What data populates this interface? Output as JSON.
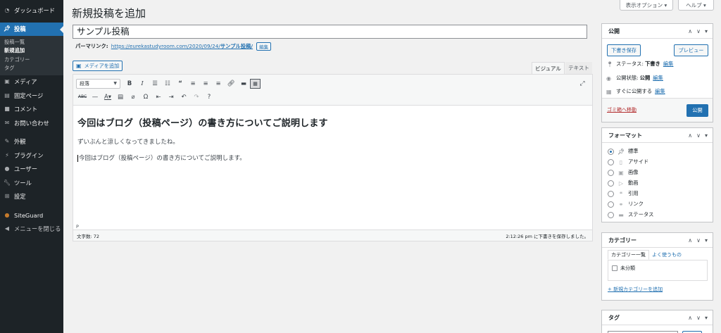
{
  "sidebar": {
    "items": [
      {
        "label": "ダッシュボード",
        "icon": "dashboard-icon"
      },
      {
        "label": "投稿",
        "icon": "pin-icon"
      },
      {
        "label": "メディア",
        "icon": "media-icon"
      },
      {
        "label": "固定ページ",
        "icon": "page-icon"
      },
      {
        "label": "コメント",
        "icon": "comment-icon"
      },
      {
        "label": "お問い合わせ",
        "icon": "mail-icon"
      },
      {
        "label": "外観",
        "icon": "brush-icon"
      },
      {
        "label": "プラグイン",
        "icon": "plugin-icon"
      },
      {
        "label": "ユーザー",
        "icon": "user-icon"
      },
      {
        "label": "ツール",
        "icon": "wrench-icon"
      },
      {
        "label": "設定",
        "icon": "settings-icon"
      },
      {
        "label": "SiteGuard",
        "icon": "siteguard-icon"
      },
      {
        "label": "メニューを閉じる",
        "icon": "collapse-icon"
      }
    ],
    "submenu": [
      "投稿一覧",
      "新規追加",
      "カテゴリー",
      "タグ"
    ]
  },
  "screen_tabs": {
    "options": "表示オプション ▾",
    "help": "ヘルプ ▾"
  },
  "page": {
    "title": "新規投稿を追加"
  },
  "post": {
    "title": "サンプル投稿",
    "permalink_label": "パーマリンク:",
    "permalink_base": "https://eurekastudyroom.com/2020/09/24/",
    "permalink_slug": "サンプル投稿/",
    "edit_label": "編集"
  },
  "editor": {
    "media_button": "メディアを追加",
    "tab_visual": "ビジュアル",
    "tab_text": "テキスト",
    "format_value": "段落",
    "heading": "今回はブログ（投稿ページ）の書き方についてご説明します",
    "paragraph1": "ずいぶんと涼しくなってきましたね。",
    "paragraph2": "今回はブログ（投稿ページ）の書き方についてご説明します。",
    "path": "P",
    "word_count": "文字数: 72",
    "autosave": "2:12:26 pm に下書きを保存しました。"
  },
  "publish": {
    "title": "公開",
    "save_draft": "下書き保存",
    "preview": "プレビュー",
    "status_label": "ステータス:",
    "status_value": "下書き",
    "visibility_label": "公開状態:",
    "visibility_value": "公開",
    "schedule_label": "すぐに公開する",
    "edit": "編集",
    "trash": "ゴミ箱へ移動",
    "publish_button": "公開"
  },
  "format": {
    "title": "フォーマット",
    "options": [
      {
        "label": "標準",
        "icon": "pin-icon",
        "checked": true
      },
      {
        "label": "アサイド",
        "icon": "aside-icon",
        "checked": false
      },
      {
        "label": "画像",
        "icon": "image-icon",
        "checked": false
      },
      {
        "label": "動画",
        "icon": "video-icon",
        "checked": false
      },
      {
        "label": "引用",
        "icon": "quote-icon",
        "checked": false
      },
      {
        "label": "リンク",
        "icon": "link-icon",
        "checked": false
      },
      {
        "label": "ステータス",
        "icon": "status-icon",
        "checked": false
      }
    ]
  },
  "category": {
    "title": "カテゴリー",
    "tab_all": "カテゴリー一覧",
    "tab_popular": "よく使うもの",
    "items": [
      "未分類"
    ],
    "add_link": "+ 新規カテゴリーを追加"
  },
  "tags": {
    "title": "タグ"
  },
  "colors": {
    "accent": "#2271b1",
    "sidebar_bg": "#1d2327",
    "trash": "#b32d2e"
  }
}
